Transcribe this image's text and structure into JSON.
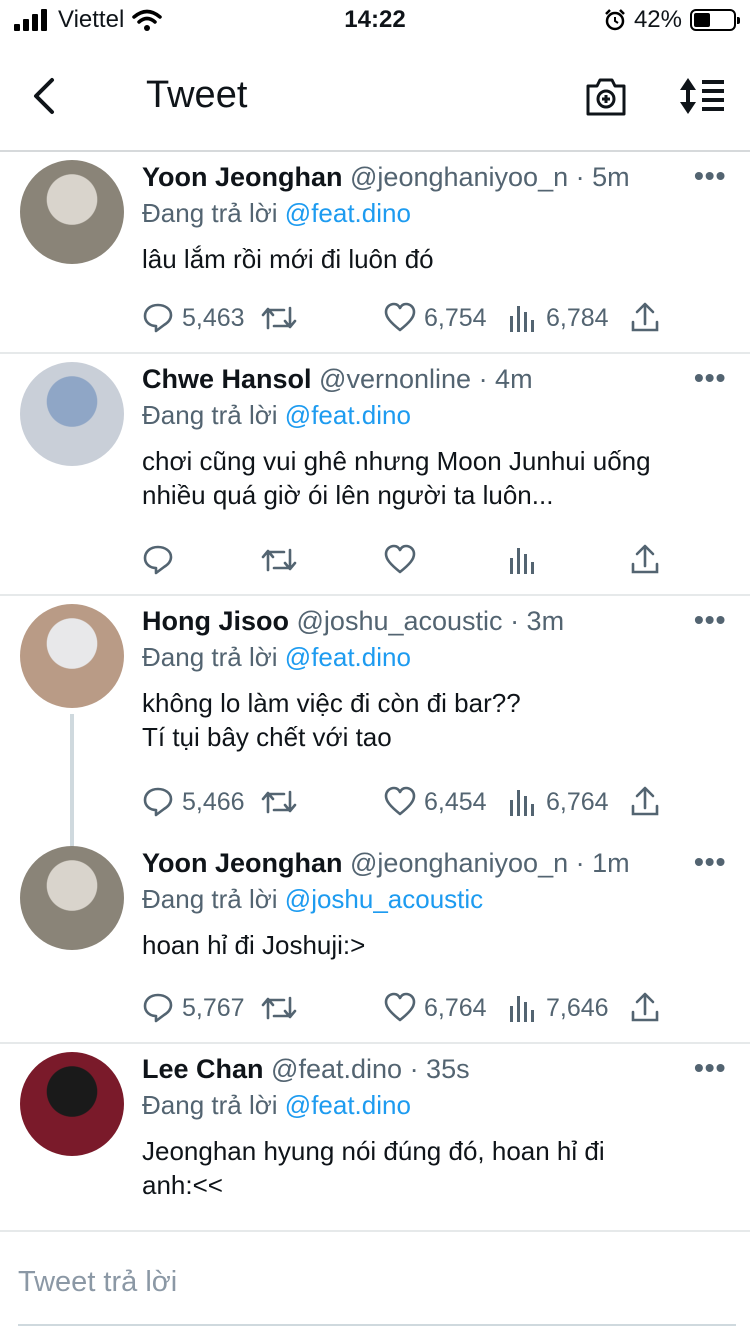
{
  "status_bar": {
    "carrier": "Viettel",
    "time": "14:22",
    "battery_percent": "42%",
    "battery_level": 0.42
  },
  "header": {
    "title": "Tweet"
  },
  "reply_prefix": "Đang trả lời",
  "tweets": [
    {
      "name": "Yoon Jeonghan",
      "handle": "@jeonghaniyoo_n",
      "time": "· 5m",
      "reply_to": "@feat.dino",
      "text_lines": [
        "lâu lắm rồi mới đi luôn đó"
      ],
      "replies": "5,463",
      "retweets": "",
      "likes": "6,754",
      "views": "6,784",
      "avatar_colors": [
        "#8a8478",
        "#d9d4cc"
      ]
    },
    {
      "name": "Chwe Hansol",
      "handle": "@vernonline",
      "time": "· 4m",
      "reply_to": "@feat.dino",
      "text_lines": [
        "chơi cũng vui ghê nhưng Moon Junhui uống",
        "nhiều quá giờ ói lên người ta luôn..."
      ],
      "replies": "",
      "retweets": "",
      "likes": "",
      "views": "",
      "avatar_colors": [
        "#c9cfd8",
        "#8fa6c6"
      ]
    },
    {
      "name": "Hong Jisoo",
      "handle": "@joshu_acoustic",
      "time": "· 3m",
      "reply_to": "@feat.dino",
      "text_lines": [
        "không lo làm việc đi còn đi bar??",
        "Tí tụi bây chết với tao"
      ],
      "replies": "5,466",
      "retweets": "",
      "likes": "6,454",
      "views": "6,764",
      "avatar_colors": [
        "#b99b86",
        "#e8e8ea"
      ]
    },
    {
      "name": "Yoon Jeonghan",
      "handle": "@jeonghaniyoo_n",
      "time": "· 1m",
      "reply_to": "@joshu_acoustic",
      "text_lines": [
        "hoan hỉ đi Joshuji:>"
      ],
      "replies": "5,767",
      "retweets": "",
      "likes": "6,764",
      "views": "7,646",
      "avatar_colors": [
        "#8a8478",
        "#d9d4cc"
      ]
    },
    {
      "name": "Lee Chan",
      "handle": "@feat.dino",
      "time": "· 35s",
      "reply_to": "@feat.dino",
      "text_lines": [
        "Jeonghan hyung nói đúng đó, hoan hỉ đi",
        "anh:<<"
      ],
      "replies": "",
      "retweets": "",
      "likes": "",
      "views": "",
      "avatar_colors": [
        "#7a1a2a",
        "#1a1a1a"
      ]
    }
  ],
  "reply_bar": {
    "placeholder": "Tweet trả lời"
  }
}
